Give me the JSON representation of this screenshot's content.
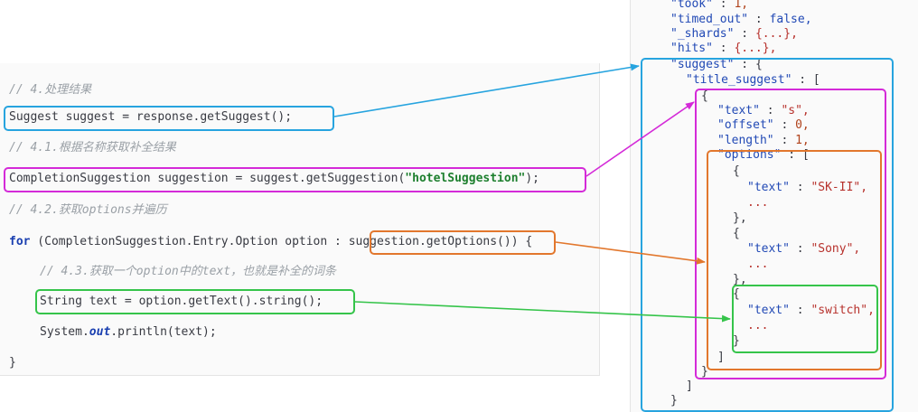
{
  "code": {
    "c1": "// 4.处理结果",
    "l1": "Suggest suggest = response.getSuggest();",
    "c2": "// 4.1.根据名称获取补全结果",
    "l2_pre": "CompletionSuggestion suggestion = suggest.getSuggestion(",
    "l2_str": "\"hotelSuggestion\"",
    "l2_post": ");",
    "c3": "// 4.2.获取options并遍历",
    "l3_kw": "for",
    "l3_mid": " (CompletionSuggestion.Entry.Option option : ",
    "l3_call": "suggestion.getOptions()",
    "l3_post": ") {",
    "c4": "// 4.3.获取一个option中的text，也就是补全的词条",
    "l4": "String text = option.getText().string();",
    "l5_pre": "System.",
    "l5_fld": "out",
    "l5_post": ".println(text);",
    "l6": "}"
  },
  "json": {
    "took_k": "\"took\"",
    "took_v": "1,",
    "to_k": "\"timed_out\"",
    "to_v": "false,",
    "sh_k": "\"_shards\"",
    "sh_v": "{...},",
    "hits_k": "\"hits\"",
    "hits_v": "{...},",
    "sug_k": "\"suggest\"",
    "sug_v": "{",
    "ts_k": "\"title_suggest\"",
    "ts_v": "[",
    "ob": "{",
    "text_k": "\"text\"",
    "text_v": "\"s\",",
    "off_k": "\"offset\"",
    "off_v": "0,",
    "len_k": "\"length\"",
    "len_v": "1,",
    "opt_k": "\"options\"",
    "opt_v": "[",
    "o1_open": "{",
    "o1_k": "\"text\"",
    "o1_v": "\"SK-II\",",
    "o1_dots": "...",
    "o1_close": "},",
    "o2_open": "{",
    "o2_k": "\"text\"",
    "o2_v": "\"Sony\",",
    "o2_dots": "...",
    "o2_close": "},",
    "o3_open": "{",
    "o3_k": "\"text\"",
    "o3_v": "\"switch\",",
    "o3_dots": "...",
    "o3_close": "}",
    "opt_close": "]",
    "ob_close": "}",
    "ts_close": "]",
    "sug_close": "}",
    "colon": " : "
  },
  "colors": {
    "blue": "#27a4df",
    "magenta": "#d42ad8",
    "orange": "#e2772d",
    "green": "#35c44a"
  }
}
